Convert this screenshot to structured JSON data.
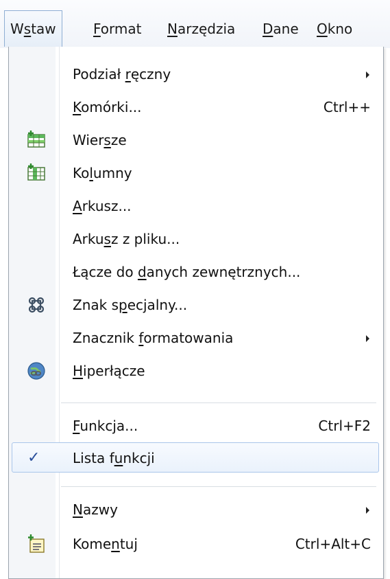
{
  "menubar": {
    "items": [
      {
        "pre": "W",
        "acc": "s",
        "post": "taw"
      },
      {
        "pre": "",
        "acc": "F",
        "post": "ormat"
      },
      {
        "pre": "",
        "acc": "N",
        "post": "arzędzia"
      },
      {
        "pre": "",
        "acc": "D",
        "post": "ane"
      },
      {
        "pre": "",
        "acc": "O",
        "post": "kno"
      }
    ]
  },
  "menu": {
    "items": [
      {
        "pre": "Podział ",
        "acc": "r",
        "post": "ęczny",
        "shortcut": ""
      },
      {
        "pre": "",
        "acc": "K",
        "post": "omórki...",
        "shortcut": "Ctrl++"
      },
      {
        "pre": "Wier",
        "acc": "s",
        "post": "ze",
        "shortcut": "",
        "icon": "insert-rows-icon"
      },
      {
        "pre": "Ko",
        "acc": "l",
        "post": "umny",
        "shortcut": "",
        "icon": "insert-columns-icon"
      },
      {
        "pre": "",
        "acc": "A",
        "post": "rkusz...",
        "shortcut": ""
      },
      {
        "pre": "Arku",
        "acc": "s",
        "post": "z z pliku...",
        "shortcut": ""
      },
      {
        "pre": "Łącze do ",
        "acc": "d",
        "post": "anych zewnętrznych...",
        "shortcut": ""
      },
      {
        "pre": "Znak s",
        "acc": "p",
        "post": "ecjalny...",
        "shortcut": "",
        "icon": "special-character-icon"
      },
      {
        "pre": "Znacznik ",
        "acc": "f",
        "post": "ormatowania",
        "shortcut": ""
      },
      {
        "pre": "",
        "acc": "H",
        "post": "iperłącze",
        "shortcut": "",
        "icon": "hyperlink-icon"
      },
      {
        "pre": "",
        "acc": "F",
        "post": "unkcja...",
        "shortcut": "Ctrl+F2"
      },
      {
        "pre": "Lista f",
        "acc": "u",
        "post": "nkcji",
        "shortcut": "",
        "checked": true
      },
      {
        "pre": "",
        "acc": "N",
        "post": "azwy",
        "shortcut": ""
      },
      {
        "pre": "Kome",
        "acc": "n",
        "post": "tuj",
        "shortcut": "Ctrl+Alt+C",
        "icon": "comment-icon"
      }
    ],
    "check_glyph": "✓"
  },
  "colors": {
    "selection_border": "#a9c5ea",
    "gutter": "#f4f6f9",
    "icon_green": "#3aa33a"
  }
}
